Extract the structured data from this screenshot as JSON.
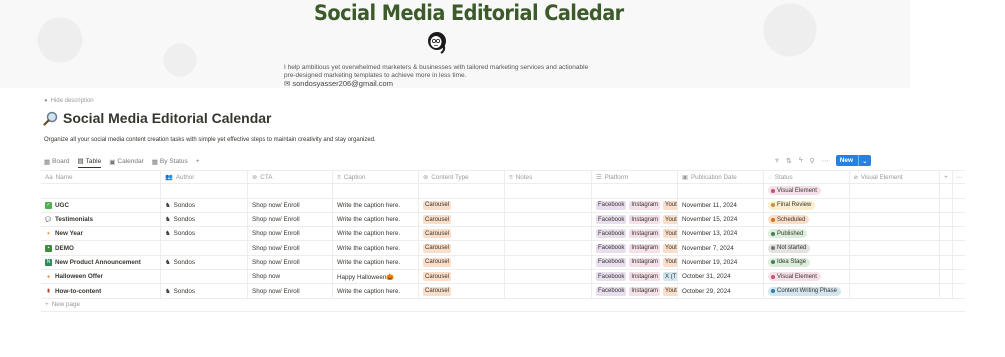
{
  "cover": {
    "title": "Social Media Editorial Caledar",
    "desc_line1": "I help ambitious yet overwhelmed marketers & businesses with tailored marketing services and actionable",
    "desc_line2": "pre-designed marketing templates to achieve more in less time.",
    "email": "sondosyasser206@gmail.com"
  },
  "page": {
    "hide_description": "Hide description",
    "title": "Social Media Editorial Calendar",
    "title_icon": "magnifier-emoji",
    "subtitle": "Organize all your social media content creation tasks with simple yet effective steps to maintain creativity and stay organized."
  },
  "views": [
    {
      "label": "Board",
      "icon": "board-icon"
    },
    {
      "label": "Table",
      "icon": "table-icon",
      "active": true
    },
    {
      "label": "Calendar",
      "icon": "calendar-icon"
    },
    {
      "label": "By Status",
      "icon": "board-icon"
    }
  ],
  "toolbar": {
    "new_label": "New"
  },
  "columns": {
    "name": "Name",
    "author": "Author",
    "cta": "CTA",
    "caption": "Caption",
    "content_type": "Content Type",
    "notes": "Notes",
    "platform": "Platform",
    "publication_date": "Publication Date",
    "status": "Status",
    "visual_element": "Visual Element"
  },
  "colors": {
    "cover_title": "#3d5a2b",
    "accent": "#2383e2",
    "tag_orange": "#fadec9",
    "tag_purple": "#e8deee",
    "tag_pink": "#f5e0e9"
  },
  "rows": [
    {
      "icon": "checkbox-green",
      "name": "",
      "author": "",
      "cta": "",
      "caption": "",
      "content_type": "",
      "platforms": [],
      "date": "",
      "status": "Visual Element",
      "status_color": "#c4546f",
      "status_bg": "#f5e0e9",
      "blank": true
    },
    {
      "icon": "checkbox-green",
      "name": "UGC",
      "author": "Sondos",
      "cta": "Shop now/ Enroll",
      "caption": "Write the caption here.",
      "content_type": "Carousel",
      "platforms": [
        "Facebook",
        "Instagram",
        "Yout"
      ],
      "date": "November 11, 2024",
      "status": "Final Review",
      "status_color": "#c29343",
      "status_bg": "#fbeecc"
    },
    {
      "icon": "speech-bubble",
      "name": "Testimonials",
      "author": "Sondos",
      "cta": "Shop now/ Enroll",
      "caption": "Write the caption here.",
      "content_type": "Carousel",
      "platforms": [
        "Facebook",
        "Instagram",
        "Yout"
      ],
      "date": "November 15, 2024",
      "status": "Scheduled",
      "status_color": "#d9730d",
      "status_bg": "#fadec9"
    },
    {
      "icon": "party-popper",
      "name": "New Year",
      "author": "Sondos",
      "cta": "Shop now/ Enroll",
      "caption": "Write the caption here.",
      "content_type": "Carousel",
      "platforms": [
        "Facebook",
        "Instagram",
        "Yout"
      ],
      "date": "November 13, 2024",
      "status": "Published",
      "status_color": "#448361",
      "status_bg": "#dbeddb"
    },
    {
      "icon": "demo-tag",
      "name": "DEMO",
      "author": "",
      "cta": "Shop now/ Enroll",
      "caption": "Write the caption here.",
      "content_type": "Carousel",
      "platforms": [
        "Facebook",
        "Instagram",
        "Yout"
      ],
      "date": "November 7, 2024",
      "status": "Not started",
      "status_color": "#787774",
      "status_bg": "#e3e2e0"
    },
    {
      "icon": "new-badge",
      "name": "New Product Announcement",
      "author": "Sondos",
      "cta": "Shop now/ Enroll",
      "caption": "Write the caption here.",
      "content_type": "Carousel",
      "platforms": [
        "Facebook",
        "Instagram",
        "Yout"
      ],
      "date": "November 19, 2024",
      "status": "Idea Stage",
      "status_color": "#448361",
      "status_bg": "#dbeddb"
    },
    {
      "icon": "pumpkin",
      "name": "Halloween Offer",
      "author": "",
      "cta": "Shop now",
      "caption": "Happy Halloween🎃",
      "content_type": "Carousel",
      "platforms": [
        "Facebook",
        "Instagram",
        "X (T"
      ],
      "date": "October 31, 2024",
      "status": "Visual Element",
      "status_color": "#c4546f",
      "status_bg": "#f5e0e9"
    },
    {
      "icon": "book",
      "name": "How-to-content",
      "author": "Sondos",
      "cta": "Shop now/ Enroll",
      "caption": "Write the caption here.",
      "content_type": "Carousel",
      "platforms": [
        "Facebook",
        "Instagram",
        "Yout"
      ],
      "date": "October 29, 2024",
      "status": "Content Writing Phase",
      "status_color": "#337ea9",
      "status_bg": "#d3e5ef"
    }
  ],
  "new_page_label": "New page"
}
